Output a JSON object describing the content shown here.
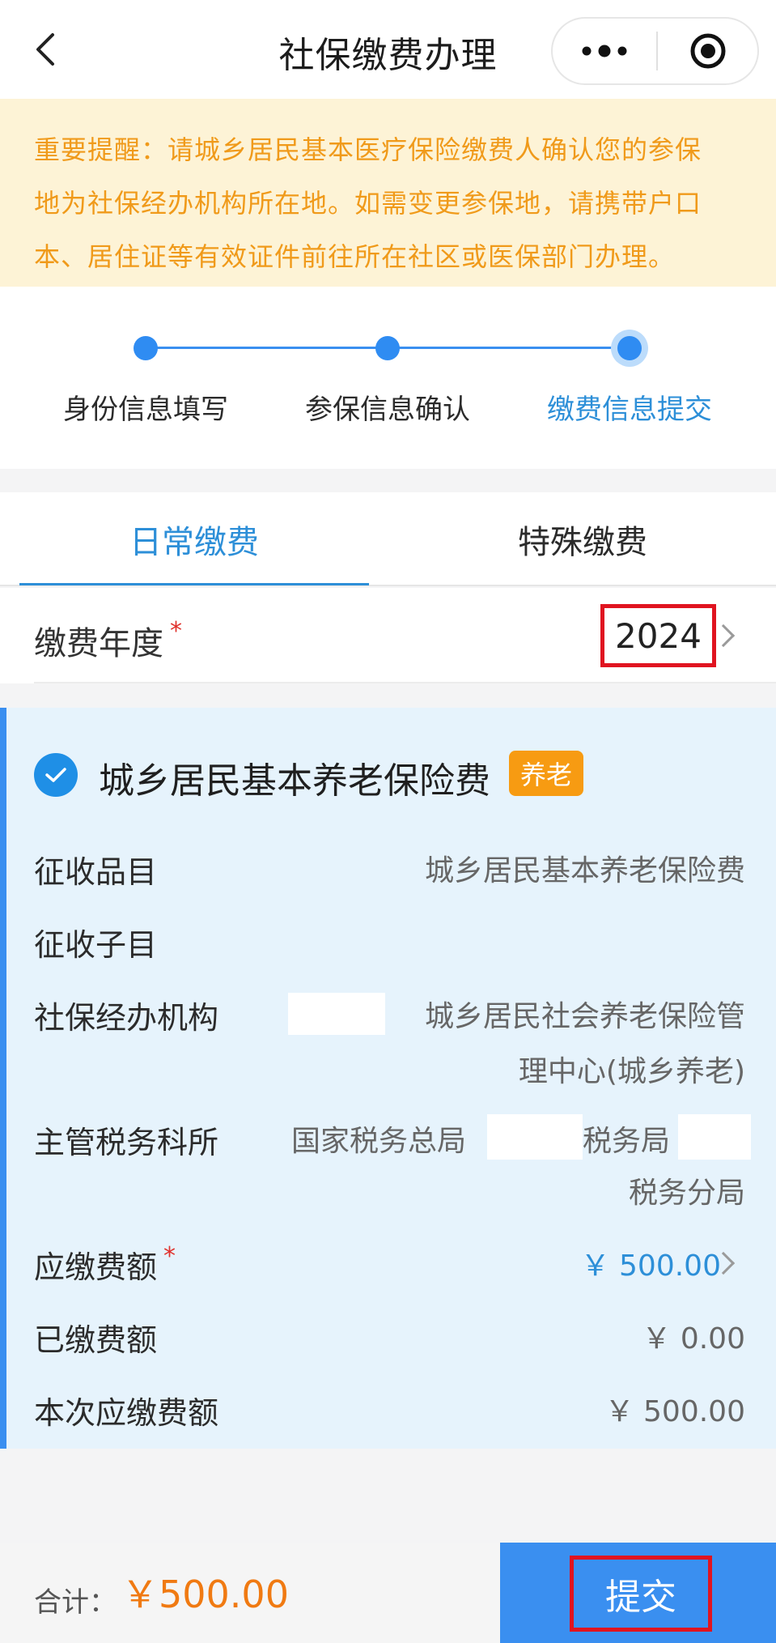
{
  "header": {
    "title": "社保缴费办理"
  },
  "notice": {
    "lines": [
      "重要提醒：请城乡居民基本医疗保险缴费人确认您的参保",
      "地为社保经办机构所在地。如需变更参保地，请携带户口",
      "本、居住证等有效证件前往所在社区或医保部门办理。"
    ]
  },
  "steps": [
    {
      "label": "身份信息填写",
      "active": false
    },
    {
      "label": "参保信息确认",
      "active": false
    },
    {
      "label": "缴费信息提交",
      "active": true
    }
  ],
  "tabs": [
    {
      "label": "日常缴费",
      "active": true
    },
    {
      "label": "特殊缴费",
      "active": false
    }
  ],
  "year": {
    "label": "缴费年度",
    "required_mark": "*",
    "value": "2024"
  },
  "card": {
    "title": "城乡居民基本养老保险费",
    "tag": "养老",
    "rows": {
      "item": {
        "label": "征收品目",
        "value": "城乡居民基本养老保险费"
      },
      "subitem": {
        "label": "征收子目",
        "value": ""
      },
      "agency": {
        "label": "社保经办机构",
        "value_line1": "城乡居民社会养老保险管",
        "value_line2": "理中心(城乡养老)"
      },
      "tax_office": {
        "label": "主管税务科所",
        "value_part1": "国家税务总局",
        "value_part2": "税务局",
        "value_line2": "税务分局"
      },
      "due": {
        "label": "应缴费额",
        "required_mark": "*",
        "value": "￥ 500.00"
      },
      "paid": {
        "label": "已缴费额",
        "value": "￥ 0.00"
      },
      "current_due": {
        "label": "本次应缴费额",
        "value": "￥ 500.00"
      }
    }
  },
  "footer": {
    "total_label": "合计：",
    "total_value": "￥500.00",
    "submit_label": "提交"
  },
  "colors": {
    "accent": "#3a8ff0",
    "link": "#2d8fd8",
    "notice_text": "#f09a1a",
    "notice_bg": "#fdf3d6",
    "tag_bg": "#f79b12",
    "total": "#f07a12",
    "highlight_box": "#e01420"
  }
}
